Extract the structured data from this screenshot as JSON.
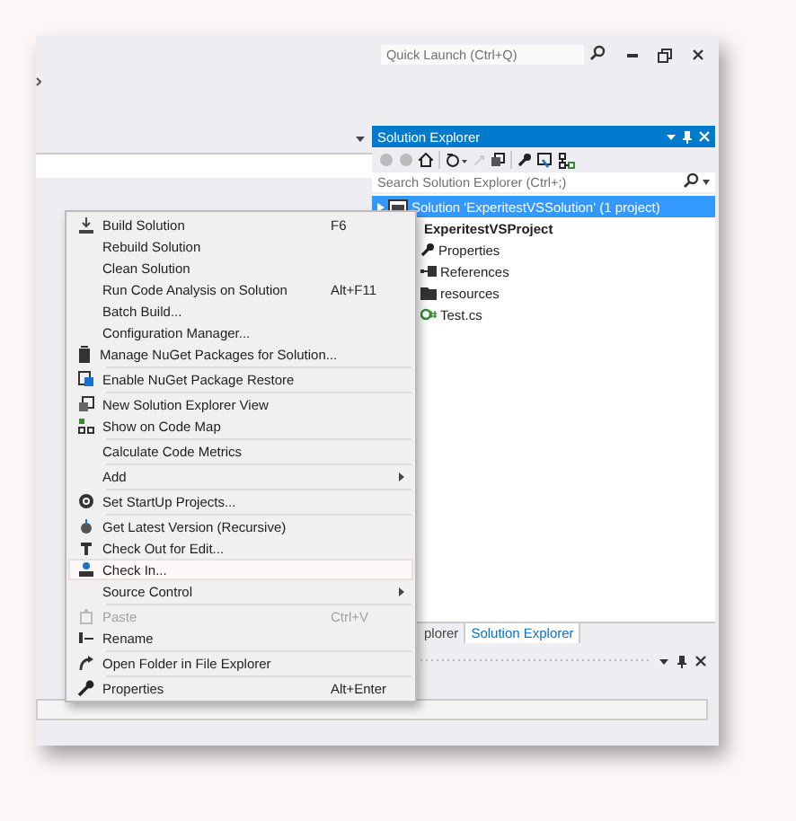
{
  "window": {
    "quick_launch": {
      "placeholder": "Quick Launch (Ctrl+Q)"
    }
  },
  "solution_explorer": {
    "title": "Solution Explorer",
    "search": {
      "placeholder": "Search Solution Explorer (Ctrl+;)"
    },
    "tree": [
      {
        "label": "Solution 'ExperitestVSSolution' (1 project)",
        "selected": true,
        "children": [
          {
            "label": "ExperitestVSProject",
            "selected": false,
            "children": [
              {
                "label": "Properties",
                "selected": false
              },
              {
                "label": "References",
                "selected": false
              },
              {
                "label": "resources",
                "selected": false
              },
              {
                "label": "Test.cs",
                "selected": false
              }
            ]
          }
        ]
      }
    ],
    "tabs": [
      {
        "label": "plorer",
        "selected": false
      },
      {
        "label": "Solution Explorer",
        "selected": true
      }
    ]
  },
  "context_menu": {
    "items": [
      {
        "kind": "command",
        "label": "Build Solution",
        "shortcut": "F6",
        "selected": false,
        "disabled": false
      },
      {
        "kind": "command",
        "label": "Rebuild Solution",
        "selected": false,
        "disabled": false
      },
      {
        "kind": "command",
        "label": "Clean Solution",
        "selected": false,
        "disabled": false
      },
      {
        "kind": "command",
        "label": "Run Code Analysis on Solution",
        "shortcut": "Alt+F11",
        "selected": false,
        "disabled": false
      },
      {
        "kind": "command",
        "label": "Batch Build...",
        "selected": false,
        "disabled": false
      },
      {
        "kind": "command",
        "label": "Configuration Manager...",
        "selected": false,
        "disabled": false
      },
      {
        "kind": "command",
        "label": "Manage NuGet Packages for Solution...",
        "selected": false,
        "disabled": false
      },
      {
        "kind": "separator"
      },
      {
        "kind": "command",
        "label": "Enable NuGet Package Restore",
        "selected": false,
        "disabled": false
      },
      {
        "kind": "separator"
      },
      {
        "kind": "command",
        "label": "New Solution Explorer View",
        "selected": false,
        "disabled": false
      },
      {
        "kind": "command",
        "label": "Show on Code Map",
        "selected": false,
        "disabled": false
      },
      {
        "kind": "separator"
      },
      {
        "kind": "command",
        "label": "Calculate Code Metrics",
        "selected": false,
        "disabled": false
      },
      {
        "kind": "separator"
      },
      {
        "kind": "submenu",
        "label": "Add",
        "selected": false,
        "disabled": false
      },
      {
        "kind": "separator"
      },
      {
        "kind": "command",
        "label": "Set StartUp Projects...",
        "selected": false,
        "disabled": false
      },
      {
        "kind": "separator"
      },
      {
        "kind": "command",
        "label": "Get Latest Version (Recursive)",
        "selected": false,
        "disabled": false
      },
      {
        "kind": "command",
        "label": "Check Out for Edit...",
        "selected": false,
        "disabled": false
      },
      {
        "kind": "command",
        "label": "Check In...",
        "selected": true,
        "disabled": false
      },
      {
        "kind": "submenu",
        "label": "Source Control",
        "selected": false,
        "disabled": false
      },
      {
        "kind": "separator"
      },
      {
        "kind": "command",
        "label": "Paste",
        "shortcut": "Ctrl+V",
        "selected": false,
        "disabled": true
      },
      {
        "kind": "command",
        "label": "Rename",
        "selected": false,
        "disabled": false
      },
      {
        "kind": "separator"
      },
      {
        "kind": "command",
        "label": "Open Folder in File Explorer",
        "selected": false,
        "disabled": false
      },
      {
        "kind": "separator"
      },
      {
        "kind": "command",
        "label": "Properties",
        "shortcut": "Alt+Enter",
        "selected": false,
        "disabled": false
      }
    ]
  }
}
